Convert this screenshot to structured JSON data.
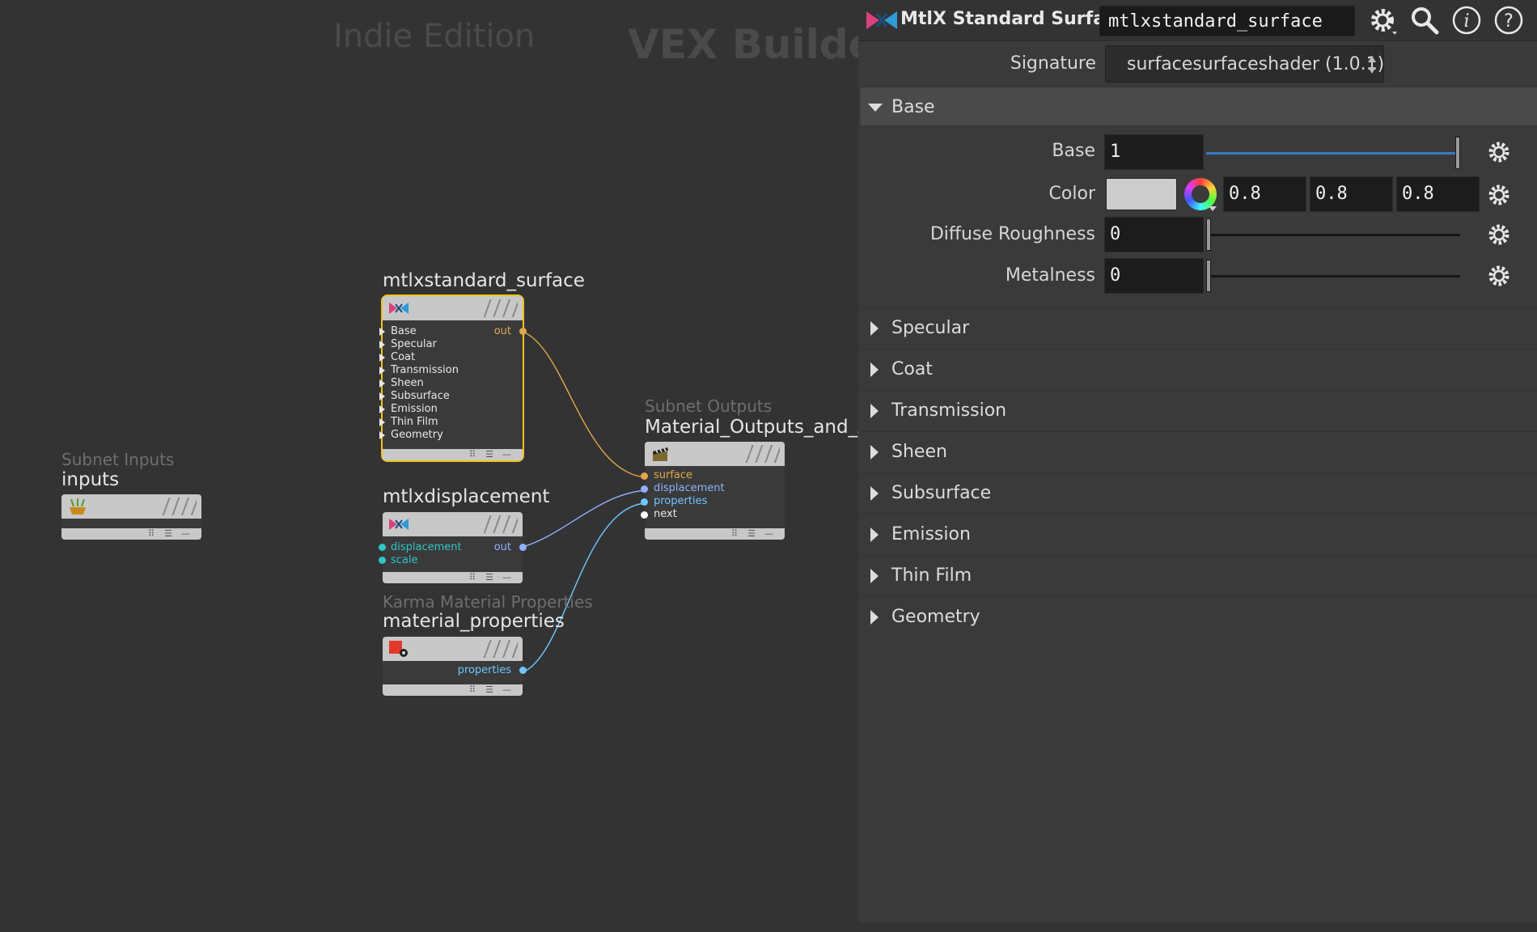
{
  "network": {
    "watermark_edition": "Indie Edition",
    "watermark_context": "VEX Builder",
    "nodes": {
      "standard_surface": {
        "name": "mtlxstandard_surface",
        "inputs": [
          "Base",
          "Specular",
          "Coat",
          "Transmission",
          "Sheen",
          "Subsurface",
          "Emission",
          "Thin Film",
          "Geometry"
        ],
        "output": "out",
        "selected_color": "#f0c419"
      },
      "displacement": {
        "name": "mtlxdisplacement",
        "inputs": [
          "displacement",
          "scale"
        ],
        "output": "out"
      },
      "material_properties": {
        "type": "Karma Material Properties",
        "name": "material_properties",
        "output": "properties"
      },
      "subnet_outputs": {
        "type": "Subnet Outputs",
        "name": "Material_Outputs_and_AO",
        "inputs": [
          "surface",
          "displacement",
          "properties",
          "next"
        ]
      },
      "subnet_inputs": {
        "type": "Subnet Inputs",
        "name": "inputs"
      }
    },
    "colors": {
      "surface_wire": "#e2a84a",
      "displacement_wire": "#8fb1ff",
      "properties_wire": "#6ec7ff",
      "cyan_port": "#2ec6c6"
    }
  },
  "parameters": {
    "op_type": "MtlX Standard Surface",
    "op_name": "mtlxstandard_surface",
    "header_icons": [
      "gear-icon",
      "search-icon",
      "info-icon",
      "help-icon"
    ],
    "signature": {
      "label": "Signature",
      "value": "surfacesurfaceshader (1.0.1)"
    },
    "folders": {
      "base": {
        "label": "Base",
        "expanded": true,
        "base": {
          "label": "Base",
          "value": "1",
          "level": 1.0
        },
        "color": {
          "label": "Color",
          "r": "0.8",
          "g": "0.8",
          "b": "0.8"
        },
        "diffuse_roughness": {
          "label": "Diffuse Roughness",
          "value": "0",
          "level": 0.0
        },
        "metalness": {
          "label": "Metalness",
          "value": "0",
          "level": 0.0
        }
      },
      "collapsed": [
        "Specular",
        "Coat",
        "Transmission",
        "Sheen",
        "Subsurface",
        "Emission",
        "Thin Film",
        "Geometry"
      ]
    }
  }
}
